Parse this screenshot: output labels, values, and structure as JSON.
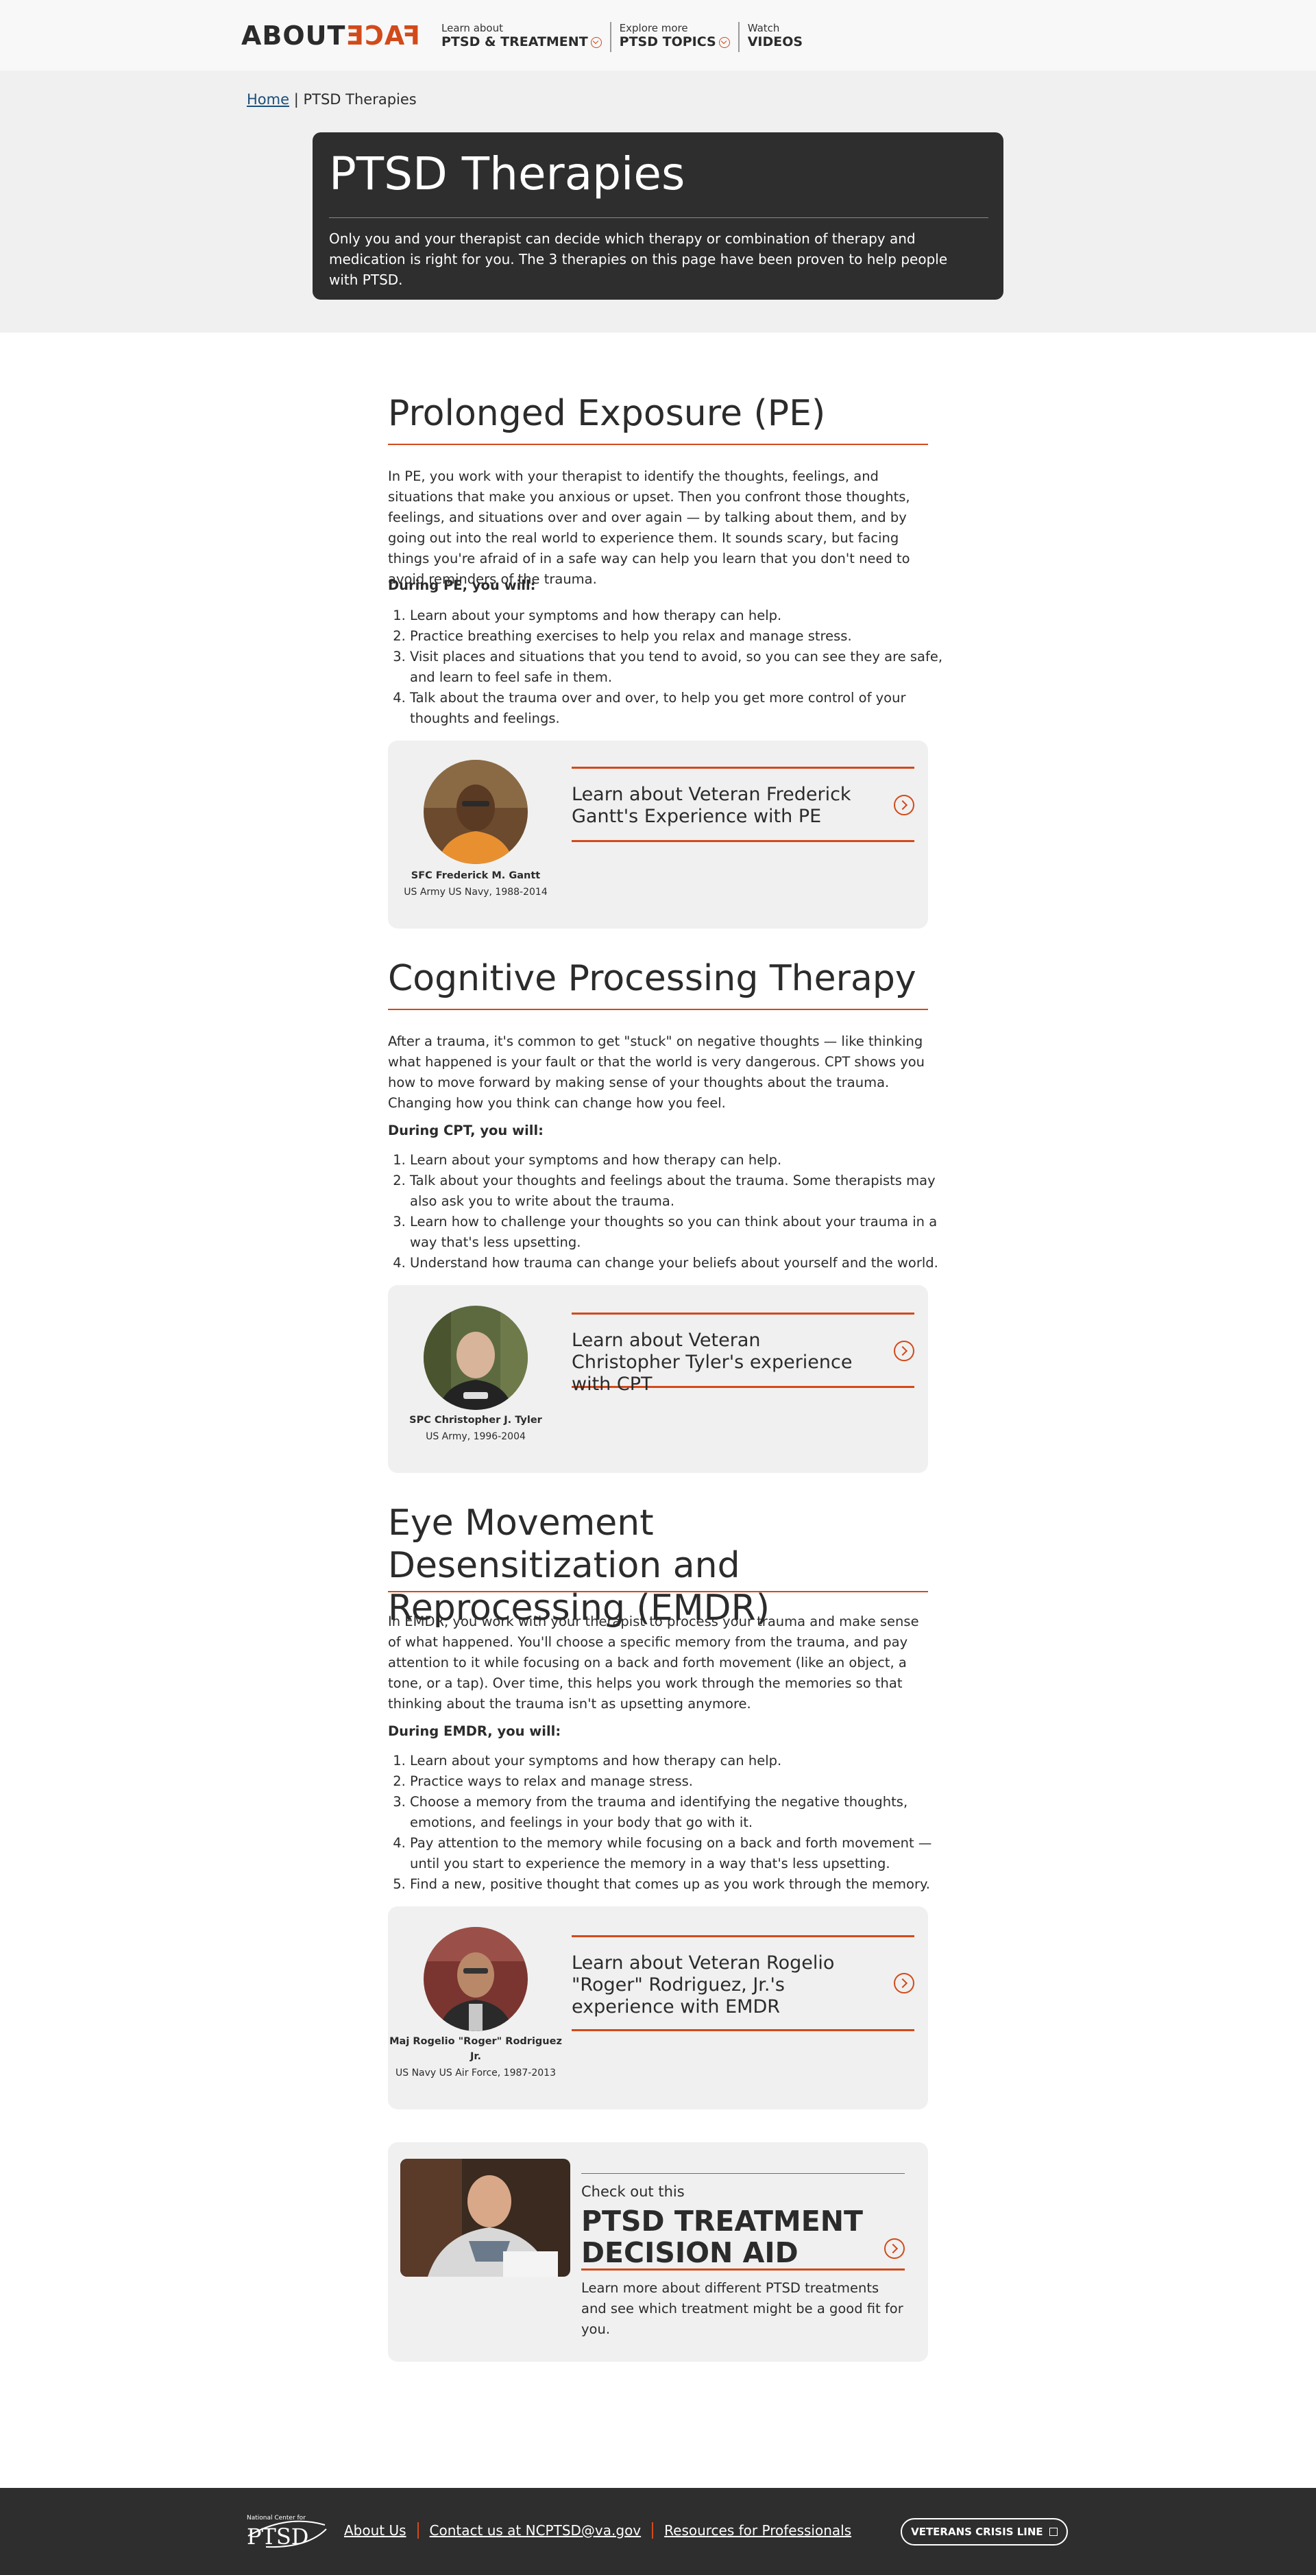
{
  "header": {
    "logo_about": "ABOUT",
    "logo_face": "FACE",
    "nav": [
      {
        "small": "Learn about",
        "big": "PTSD & TREATMENT",
        "has_chevron": true
      },
      {
        "small": "Explore more",
        "big": "PTSD TOPICS",
        "has_chevron": true
      },
      {
        "small": "Watch",
        "big": "VIDEOS",
        "has_chevron": false
      }
    ]
  },
  "breadcrumb": {
    "home": "Home",
    "separator": "|",
    "current": "PTSD Therapies"
  },
  "hero": {
    "title": "PTSD Therapies",
    "text": "Only you and your therapist can decide which therapy or combination of therapy and medication is right for you. The 3 therapies on this page have been proven to help people with PTSD."
  },
  "sections": [
    {
      "title": "Prolonged Exposure (PE)",
      "intro": "In PE, you work with your therapist to identify the thoughts, feelings, and situations that make you anxious or upset. Then you confront those thoughts, feelings, and situations over and over again — by talking about them, and by going out into the real world to experience them. It sounds scary, but facing things you're afraid of in a safe way can help you learn that you don't need to avoid reminders of the trauma.",
      "steps_label": "During PE, you will:",
      "steps": [
        "Learn about your symptoms and how therapy can help.",
        "Practice breathing exercises to help you relax and manage stress.",
        "Visit places and situations that you tend to avoid, so you can see they are safe, and learn to feel safe in them.",
        "Talk about the trauma over and over, to help you get more control of your thoughts and feelings."
      ],
      "veteran": {
        "name": "SFC Frederick M. Gantt",
        "service": "US Army US Navy, 1988-2014",
        "link": "Learn about Veteran Frederick Gantt's Experience with PE"
      }
    },
    {
      "title": "Cognitive Processing Therapy",
      "intro": "After a trauma, it's common to get \"stuck\" on negative thoughts — like thinking what happened is your fault or that the world is very dangerous. CPT shows you how to move forward by making sense of your thoughts about the trauma. Changing how you think can change how you feel.",
      "steps_label": "During CPT, you will:",
      "steps": [
        "Learn about your symptoms and how therapy can help.",
        "Talk about your thoughts and feelings about the trauma. Some therapists may also ask you to write about the trauma.",
        "Learn how to challenge your thoughts so you can think about your trauma in a way that's less upsetting.",
        "Understand how trauma can change your beliefs about yourself and the world."
      ],
      "veteran": {
        "name": "SPC Christopher J. Tyler",
        "service": "US Army, 1996-2004",
        "link": "Learn about Veteran Christopher Tyler's experience with CPT"
      }
    },
    {
      "title": "Eye Movement Desensitization and Reprocessing (EMDR)",
      "intro": "In EMDR, you work with your therapist to process your trauma and make sense of what happened. You'll choose a specific memory from the trauma, and pay attention to it while focusing on a back and forth movement (like an object, a tone, or a tap). Over time, this helps you work through the memories so that thinking about the trauma isn't as upsetting anymore.",
      "steps_label": "During EMDR, you will:",
      "steps": [
        "Learn about your symptoms and how therapy can help.",
        "Practice ways to relax and manage stress.",
        "Choose a memory from the trauma and identifying the negative thoughts, emotions, and feelings in your body that go with it.",
        "Pay attention to the memory while focusing on a back and forth movement — until you start to experience the memory in a way that's less upsetting.",
        "Find a new, positive thought that comes up as you work through the memory."
      ],
      "veteran": {
        "name": "Maj Rogelio \"Roger\" Rodriguez Jr.",
        "service": "US Navy US Air Force, 1987-2013",
        "link": "Learn about Veteran Rogelio \"Roger\" Rodriguez, Jr.'s experience with EMDR"
      }
    }
  ],
  "decision_aid": {
    "kicker": "Check out this",
    "title": "PTSD TREATMENT DECISION AID",
    "text": "Learn more about different PTSD treatments and see which treatment might be a good fit for you."
  },
  "footer": {
    "logo_small": "National Center for",
    "logo_big": "PTSD",
    "links": [
      "About Us",
      "Contact us at NCPTSD@va.gov",
      "Resources for Professionals"
    ],
    "crisis": "VETERANS CRISIS LINE"
  },
  "colors": {
    "accent": "#d24a1a",
    "dark": "#2e2e2e",
    "light_panel": "#f0f0f0",
    "link": "#1a4f7a"
  }
}
